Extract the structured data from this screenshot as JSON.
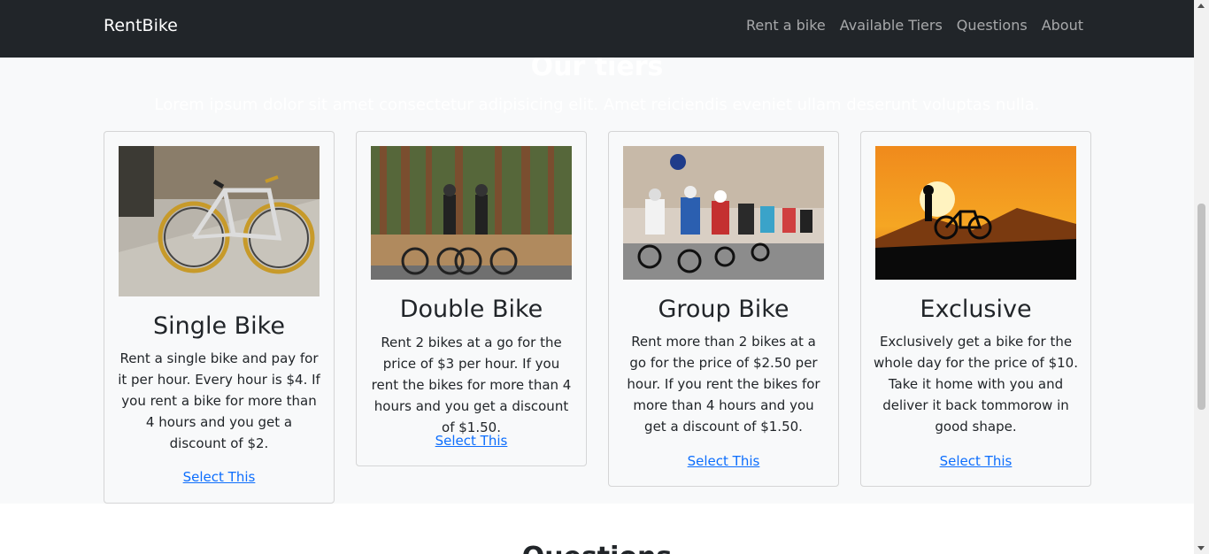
{
  "navbar": {
    "brand": "RentBike",
    "links": [
      "Rent a bike",
      "Available Tiers",
      "Questions",
      "About"
    ]
  },
  "hero": {
    "title": "Our tiers",
    "text": "Lorem ipsum dolor sit amet consectetur adipisicing elit. Amet reiciendis eveniet ullam deserunt voluptas nulla."
  },
  "cards": [
    {
      "title": "Single Bike",
      "text": "Rent a single bike and pay for it per hour. Every hour is $4. If you rent a bike for more than 4 hours and you get a discount of $2.",
      "link": "Select This"
    },
    {
      "title": "Double Bike",
      "text": "Rent 2 bikes at a go for the price of $3 per hour. If you rent the bikes for more than 4 hours and you get a discount of $1.50.",
      "link": "Select This"
    },
    {
      "title": "Group Bike",
      "text": "Rent more than 2 bikes at a go for the price of $2.50 per hour. If you rent the bikes for more than 4 hours and you get a discount of $1.50.",
      "link": "Select This"
    },
    {
      "title": "Exclusive",
      "text": "Exclusively get a bike for the whole day for the price of $10. Take it home with you and deliver it back tommorow in good shape.",
      "link": "Select This"
    }
  ],
  "next_section_title": "Questions"
}
